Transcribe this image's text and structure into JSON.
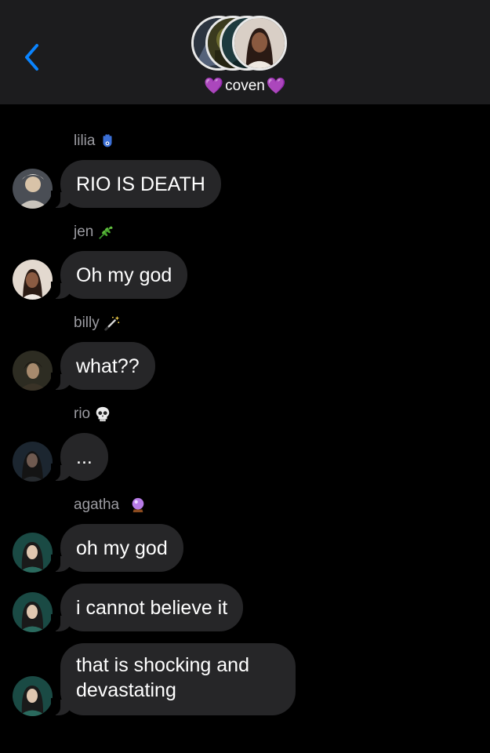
{
  "header": {
    "back_icon": "chevron-left-icon",
    "group_name": "coven",
    "heart_emoji": "💜",
    "accent": "#0a84ff"
  },
  "messages": [
    {
      "sender": "lilia",
      "sender_emoji": "hamsa",
      "text": "RIO IS DEATH"
    },
    {
      "sender": "jen",
      "sender_emoji": "herb",
      "text": "Oh my god"
    },
    {
      "sender": "billy",
      "sender_emoji": "magic-wand",
      "text": "what??"
    },
    {
      "sender": "rio",
      "sender_emoji": "skull",
      "text": "..."
    },
    {
      "sender": "agatha",
      "sender_emoji": "crystal-ball",
      "text": "oh my god"
    },
    {
      "sender": "",
      "text": "i cannot believe it"
    },
    {
      "sender": "",
      "text": "that is shocking and devastating"
    }
  ],
  "colors": {
    "header_bg": "#1c1c1e",
    "bubble_bg": "#262628",
    "sender_name": "#9b9ba1"
  }
}
